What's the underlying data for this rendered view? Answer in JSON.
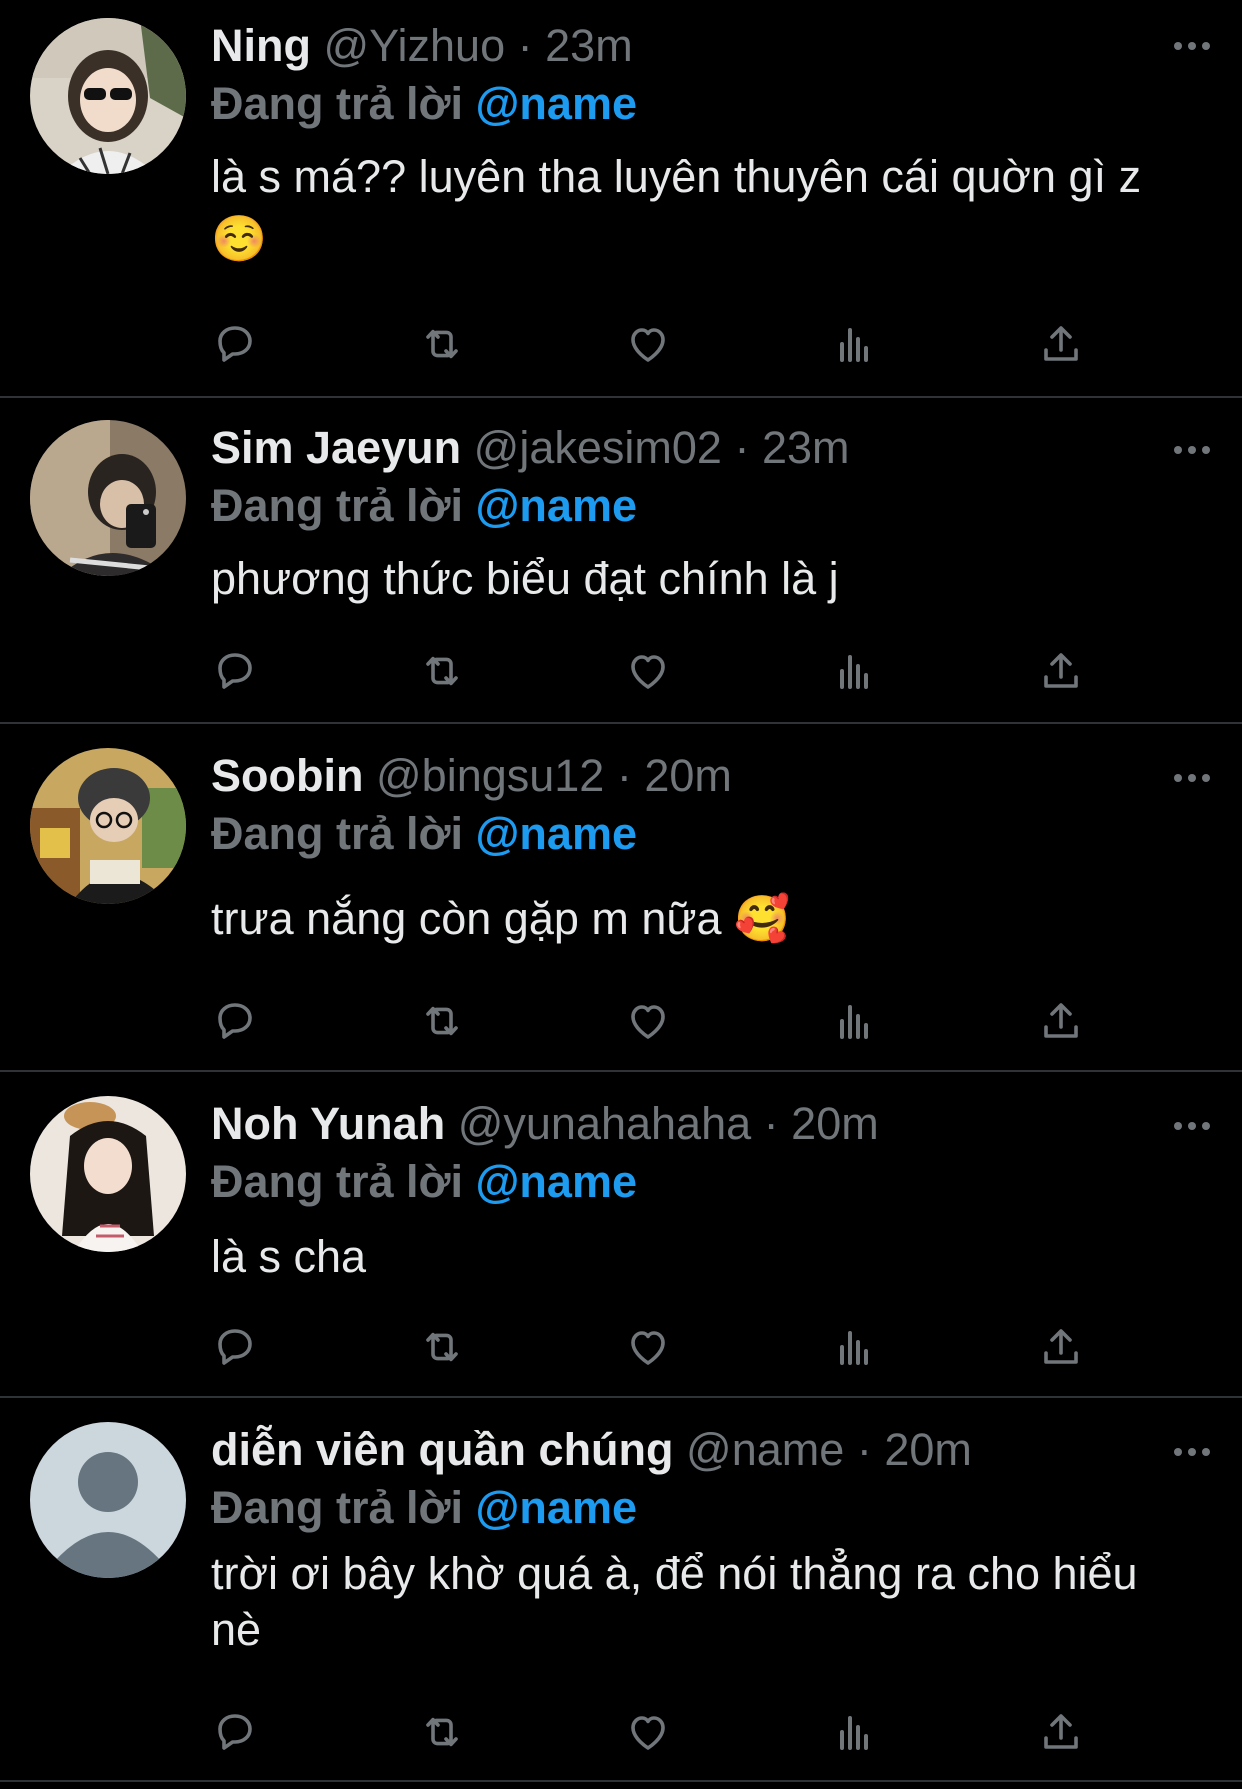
{
  "tweets": [
    {
      "name": "Ning",
      "handle": "@Yizhuo",
      "time": "23m",
      "replying_prefix": "Đang trả lời",
      "replying_to": "@name",
      "text": "là s má?? luyên tha luyên thuyên cái quờn gì z ☺️"
    },
    {
      "name": "Sim Jaeyun",
      "handle": "@jakesim02",
      "time": "23m",
      "replying_prefix": "Đang trả lời",
      "replying_to": "@name",
      "text": "phương thức biểu đạt chính là j"
    },
    {
      "name": "Soobin",
      "handle": "@bingsu12",
      "time": "20m",
      "replying_prefix": "Đang trả lời",
      "replying_to": "@name",
      "text": "trưa nắng còn gặp m nữa 🥰"
    },
    {
      "name": "Noh Yunah",
      "handle": "@yunahahaha",
      "time": "20m",
      "replying_prefix": "Đang trả lời",
      "replying_to": "@name",
      "text": "là s cha"
    },
    {
      "name": "diễn viên quần chúng",
      "handle": "@name",
      "time": "20m",
      "replying_prefix": "Đang trả lời",
      "replying_to": "@name",
      "text": "trời ơi bây khờ quá à, để nói thẳng ra cho hiểu nè"
    }
  ],
  "separator": "·",
  "icons": {
    "reply": "reply-icon",
    "retweet": "retweet-icon",
    "like": "like-icon",
    "views": "views-icon",
    "share": "share-icon",
    "more": "more-icon"
  },
  "colors": {
    "background": "#000000",
    "text": "#e7e9ea",
    "muted": "#71767b",
    "accent": "#1d9bf0",
    "divider": "#2f3336"
  }
}
